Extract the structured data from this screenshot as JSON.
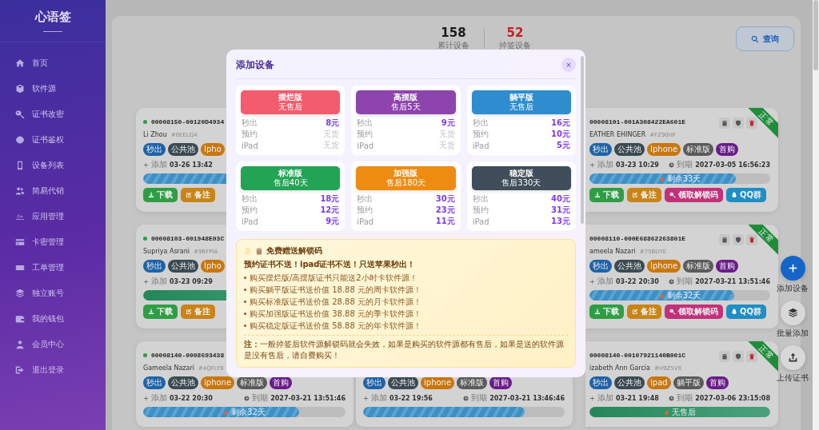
{
  "sidebar": {
    "logo": "心语签",
    "items": [
      {
        "label": "首页"
      },
      {
        "label": "软件源"
      },
      {
        "label": "证书改密"
      },
      {
        "label": "证书鉴权"
      },
      {
        "label": "设备列表"
      },
      {
        "label": "简易代销"
      },
      {
        "label": "应用管理"
      },
      {
        "label": "卡密管理"
      },
      {
        "label": "工单管理"
      },
      {
        "label": "独立账号"
      },
      {
        "label": "我的钱包"
      },
      {
        "label": "会员中心"
      },
      {
        "label": "退出登录"
      }
    ]
  },
  "stats": [
    {
      "value": "158",
      "label": "累计设备",
      "kind": "total"
    },
    {
      "value": "52",
      "label": "掉签设备",
      "kind": "lost"
    }
  ],
  "search_button": "查询",
  "columns": [
    {
      "cards": [
        {
          "online": true,
          "id": "00008150-00120D4934",
          "name": "Li Zhou",
          "tag": "#0EELQ4",
          "chips": [
            {
              "text": "秒出",
              "color": "#1e63a8"
            },
            {
              "text": "公共池",
              "color": "#3b4a52"
            },
            {
              "text": "Ipho",
              "color": "#c8770f"
            }
          ],
          "added_label": "添加",
          "added": "03-26 13:42",
          "bar": {
            "kind": "striped",
            "level": 0.9
          },
          "buttons": [
            {
              "kind": "download",
              "label": "下载"
            },
            {
              "kind": "note",
              "label": "备注"
            }
          ]
        },
        {
          "online": true,
          "id": "00008103-001948E03C",
          "name": "Supriya Asrani",
          "tag": "#9BFPIA",
          "chips": [
            {
              "text": "秒出",
              "color": "#1e63a8"
            },
            {
              "text": "公共池",
              "color": "#3b4a52"
            },
            {
              "text": "Ipho",
              "color": "#c8770f"
            }
          ],
          "added_label": "添加",
          "added": "03-23 09:29",
          "bar": {
            "kind": "solid",
            "level": 1
          },
          "buttons": [
            {
              "kind": "download",
              "label": "下载"
            },
            {
              "kind": "note",
              "label": "备注"
            }
          ]
        },
        {
          "online": true,
          "id": "00008140-0008693438",
          "name": "Gameela Nazari",
          "tag": "#4QFLY9",
          "chips": [
            {
              "text": "秒出",
              "color": "#1e63a8"
            },
            {
              "text": "公共池",
              "color": "#3b4a52"
            },
            {
              "text": "iphone",
              "color": "#c8770f"
            },
            {
              "text": "标准版",
              "color": "#5a5a5a"
            },
            {
              "text": "首购",
              "color": "#6a1b8a"
            }
          ],
          "added_label": "添加",
          "added": "03-22 20:30",
          "expire_label": "到期",
          "expires": "2027-03-21 13:51:46",
          "bar": {
            "kind": "striped",
            "level": 0.77,
            "label": "剩余32天"
          }
        }
      ]
    },
    {
      "cards": [
        {
          "chips": [
            {
              "text": "秒出",
              "color": "#1e63a8"
            },
            {
              "text": "公共池",
              "color": "#3b4a52"
            },
            {
              "text": "iphone",
              "color": "#c8770f"
            },
            {
              "text": "标准版",
              "color": "#5a5a5a"
            },
            {
              "text": "首购",
              "color": "#6a1b8a"
            }
          ],
          "added_label": "添加",
          "added": "03-22 19:56",
          "expire_label": "到期",
          "expires": "2027-03-21 13:46:46",
          "bar": {
            "kind": "striped",
            "level": 0.8
          }
        }
      ]
    },
    {
      "cards": [
        {
          "id": "00008101-001A308422EA601E",
          "name": "EATHER EHINGER",
          "tag": "#FZ90HF",
          "status": "正常",
          "tools": [
            {
              "kind": "clipboard"
            },
            {
              "kind": "shield"
            },
            {
              "kind": "trash"
            }
          ],
          "chips": [
            {
              "text": "秒出",
              "color": "#1e63a8"
            },
            {
              "text": "公共池",
              "color": "#3b4a52"
            },
            {
              "text": "Iphone",
              "color": "#c8770f"
            },
            {
              "text": "标准版",
              "color": "#5a5a5a"
            },
            {
              "text": "首购",
              "color": "#6a1b8a"
            }
          ],
          "added_label": "添加",
          "added": "03-23 10:29",
          "expire_label": "到期",
          "expires": "2027-03-05 16:56:23",
          "bar": {
            "kind": "striped",
            "level": 0.81,
            "label": "剩余33天"
          },
          "buttons": [
            {
              "kind": "download",
              "label": "下载"
            },
            {
              "kind": "note",
              "label": "备注"
            },
            {
              "kind": "unlock",
              "label": "领取解锁码"
            },
            {
              "kind": "qq",
              "label": "QQ群"
            }
          ]
        },
        {
          "id": "00008110-000E68862263801E",
          "name": "ameela Nazari",
          "tag": "#75BUYE",
          "status": "正常",
          "tools": [
            {
              "kind": "clipboard"
            },
            {
              "kind": "shield"
            },
            {
              "kind": "trash"
            }
          ],
          "chips": [
            {
              "text": "秒出",
              "color": "#1e63a8"
            },
            {
              "text": "公共池",
              "color": "#3b4a52"
            },
            {
              "text": "Iphone",
              "color": "#c8770f"
            },
            {
              "text": "标准版",
              "color": "#5a5a5a"
            },
            {
              "text": "首购",
              "color": "#6a1b8a"
            }
          ],
          "added_label": "添加",
          "added": "03-22 20:30",
          "expire_label": "到期",
          "expires": "2027-03-21 13:51:46",
          "bar": {
            "kind": "striped",
            "level": 0.8,
            "label": "剩余32天"
          },
          "buttons": [
            {
              "kind": "download",
              "label": "下载"
            },
            {
              "kind": "note",
              "label": "备注"
            },
            {
              "kind": "unlock",
              "label": "领取解锁码"
            },
            {
              "kind": "qq",
              "label": "QQ群"
            }
          ]
        },
        {
          "id": "00008140-00107921140B001C",
          "name": "izabeth Ann Garcia",
          "tag": "#H9Z5VX",
          "status": "正常",
          "tools": [
            {
              "kind": "clipboard"
            },
            {
              "kind": "shield"
            },
            {
              "kind": "trash"
            }
          ],
          "chips": [
            {
              "text": "秒出",
              "color": "#1e63a8"
            },
            {
              "text": "公共池",
              "color": "#3b4a52"
            },
            {
              "text": "ipad",
              "color": "#c8770f"
            },
            {
              "text": "躺平版",
              "color": "#5a5a5a"
            },
            {
              "text": "首购",
              "color": "#6a1b8a"
            }
          ],
          "added_label": "添加",
          "added": "03-21 19:48",
          "expire_label": "到期",
          "expires": "2027-03-06 23:15:08",
          "bar": {
            "kind": "solid",
            "level": 1,
            "label": "无售后"
          }
        }
      ]
    }
  ],
  "fabs": [
    {
      "kind": "add",
      "label": "添加设备"
    },
    {
      "kind": "batch",
      "label": "批量添加"
    },
    {
      "kind": "upload",
      "label": "上传证书"
    }
  ],
  "modal": {
    "title": "添加设备",
    "close": "×",
    "plans": [
      {
        "name": "摆烂版",
        "subtitle": "无售后",
        "color": "#f25c6c",
        "rows": [
          {
            "label": "秒出",
            "price": "8元",
            "in_stock": true
          },
          {
            "label": "预约",
            "price": "无货",
            "in_stock": false
          },
          {
            "label": "iPad",
            "price": "无货",
            "in_stock": false
          }
        ]
      },
      {
        "name": "高摆版",
        "subtitle": "售后5天",
        "color": "#8e44ad",
        "rows": [
          {
            "label": "秒出",
            "price": "9元",
            "in_stock": true
          },
          {
            "label": "预约",
            "price": "无货",
            "in_stock": false
          },
          {
            "label": "iPad",
            "price": "无货",
            "in_stock": false
          }
        ]
      },
      {
        "name": "躺平版",
        "subtitle": "无售后",
        "color": "#2e8ccf",
        "rows": [
          {
            "label": "秒出",
            "price": "16元",
            "in_stock": true
          },
          {
            "label": "预约",
            "price": "10元",
            "in_stock": true
          },
          {
            "label": "iPad",
            "price": "5元",
            "in_stock": true
          }
        ]
      },
      {
        "name": "标准版",
        "subtitle": "售后40天",
        "color": "#23a455",
        "rows": [
          {
            "label": "秒出",
            "price": "18元",
            "in_stock": true
          },
          {
            "label": "预约",
            "price": "12元",
            "in_stock": true
          },
          {
            "label": "iPad",
            "price": "9元",
            "in_stock": true
          }
        ]
      },
      {
        "name": "加强版",
        "subtitle": "售后180天",
        "color": "#ee8c12",
        "rows": [
          {
            "label": "秒出",
            "price": "30元",
            "in_stock": true
          },
          {
            "label": "预约",
            "price": "23元",
            "in_stock": true
          },
          {
            "label": "iPad",
            "price": "11元",
            "in_stock": true
          }
        ]
      },
      {
        "name": "稳定版",
        "subtitle": "售后330天",
        "color": "#3f4e5a",
        "rows": [
          {
            "label": "秒出",
            "price": "40元",
            "in_stock": true
          },
          {
            "label": "预约",
            "price": "31元",
            "in_stock": true
          },
          {
            "label": "iPad",
            "price": "13元",
            "in_stock": true
          }
        ]
      }
    ],
    "notice": {
      "title": "免费赠送解锁码",
      "headline": "预约证书不送！ipad证书不送！只送苹果秒出！",
      "items": [
        "购买摆烂版/高摆版证书只能送2小时卡软件源！",
        "购买躺平版证书送价值 18.88 元的周卡软件源！",
        "购买标准版证书送价值 28.88 元的月卡软件源！",
        "购买加强版证书送价值 38.88 元的季卡软件源！",
        "购买稳定版证书送价值 58.88 元的年卡软件源！"
      ],
      "note": "**注：**一般掉签后软件源解锁码就会失效，如果是购买的软件源都有售后，如果是送的软件源是没有售后，请自费购买！"
    }
  }
}
